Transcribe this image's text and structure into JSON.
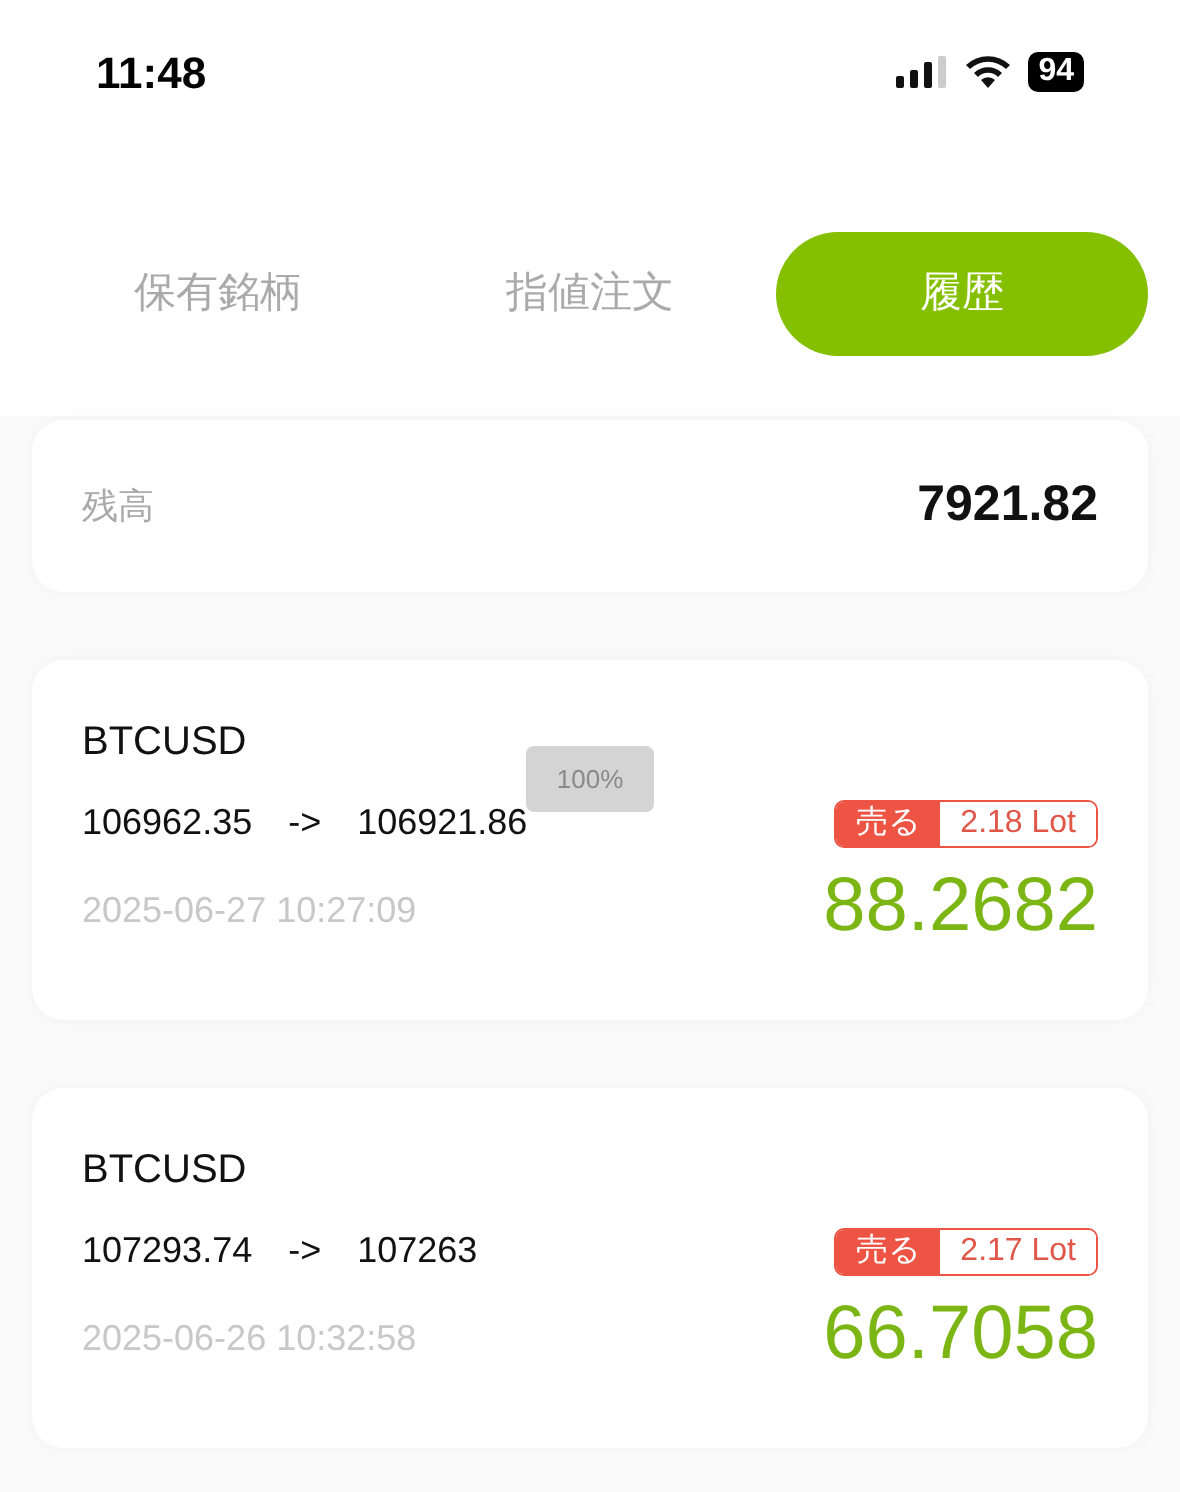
{
  "status_bar": {
    "time": "11:48",
    "battery": "94"
  },
  "tabs": [
    {
      "label": "保有銘柄",
      "selected": false
    },
    {
      "label": "指値注文",
      "selected": false
    },
    {
      "label": "履歴",
      "selected": true
    }
  ],
  "balance": {
    "label": "残高",
    "value": "7921.82"
  },
  "trades": [
    {
      "symbol": "BTCUSD",
      "open_price": "106962.35",
      "arrow": "->",
      "close_price": "106921.86",
      "time": "2025-06-27 10:27:09",
      "kind": "sell",
      "side": "売る",
      "lots": "2.18 Lot",
      "profit": "88.2682"
    },
    {
      "symbol": "BTCUSD",
      "open_price": "107293.74",
      "arrow": "->",
      "close_price": "107263",
      "time": "2025-06-26 10:32:58",
      "kind": "sell",
      "side": "売る",
      "lots": "2.17 Lot",
      "profit": "66.7058"
    }
  ],
  "zoom_toast": "100%"
}
